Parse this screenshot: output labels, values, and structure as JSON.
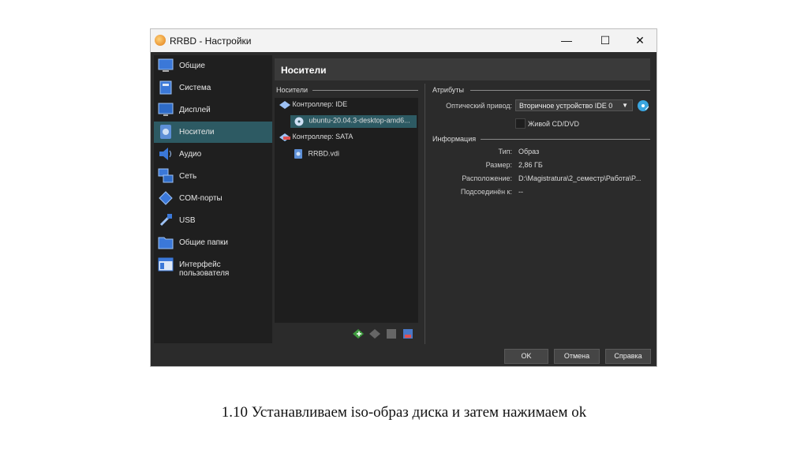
{
  "window": {
    "title": "RRBD - Настройки"
  },
  "window_controls": {
    "minimize": "—",
    "maximize": "☐",
    "close": "✕"
  },
  "sidebar": {
    "items": [
      {
        "label": "Общие",
        "icon": "general-icon"
      },
      {
        "label": "Система",
        "icon": "system-icon"
      },
      {
        "label": "Дисплей",
        "icon": "display-icon"
      },
      {
        "label": "Носители",
        "icon": "storage-icon",
        "active": true
      },
      {
        "label": "Аудио",
        "icon": "audio-icon"
      },
      {
        "label": "Сеть",
        "icon": "network-icon"
      },
      {
        "label": "COM-порты",
        "icon": "serial-ports-icon"
      },
      {
        "label": "USB",
        "icon": "usb-icon"
      },
      {
        "label": "Общие папки",
        "icon": "shared-folders-icon"
      },
      {
        "label": "Интерфейс пользователя",
        "icon": "user-interface-icon"
      }
    ]
  },
  "page": {
    "header": "Носители"
  },
  "storage": {
    "section_title": "Носители",
    "tree": [
      {
        "label": "Контроллер: IDE",
        "icon": "ide-controller-icon"
      },
      {
        "label": "ubuntu-20.04.3-desktop-amd6...",
        "icon": "optical-disc-icon",
        "selected": true
      },
      {
        "label": "Контроллер: SATA",
        "icon": "sata-controller-icon"
      },
      {
        "label": "RRBD.vdi",
        "icon": "hard-disk-icon"
      }
    ],
    "toolbar_icons": [
      "add-controller-icon",
      "remove-controller-icon",
      "add-attachment-icon",
      "remove-attachment-icon"
    ]
  },
  "attributes": {
    "section_title": "Атрибуты",
    "optical_drive_label": "Оптический привод:",
    "optical_drive_value": "Вторичное устройство IDE 0",
    "live_cd_label": "Живой CD/DVD",
    "live_cd_checked": false
  },
  "information": {
    "section_title": "Информация",
    "rows": [
      {
        "label": "Тип:",
        "value": "Образ"
      },
      {
        "label": "Размер:",
        "value": "2,86 ГБ"
      },
      {
        "label": "Расположение:",
        "value": "D:\\Magistratura\\2_семестр\\Работа\\P..."
      },
      {
        "label": "Подсоединён к:",
        "value": "--"
      }
    ]
  },
  "buttons": {
    "ok": "OK",
    "cancel": "Отмена",
    "help": "Справка"
  },
  "caption": "1.10 Устанавливаем iso-образ диска и затем нажимаем ok",
  "colors": {
    "accent": "#2d5a63",
    "window_bg": "#2b2b2b",
    "sidebar_bg": "#1f1f1f"
  }
}
